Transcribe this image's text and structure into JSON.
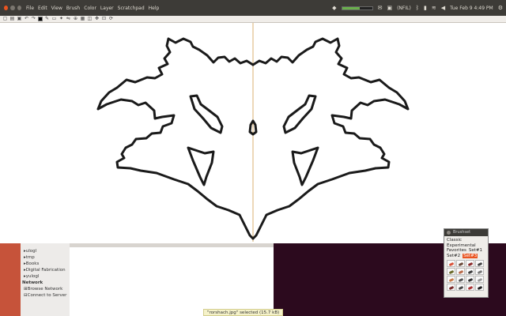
{
  "menubar": {
    "items": [
      "File",
      "Edit",
      "View",
      "Brush",
      "Color",
      "Layer",
      "Scratchpad",
      "Help"
    ]
  },
  "tray": {
    "keyboard": "(NFIL)",
    "battery_level": 0.6,
    "clock": "Tue Feb 9 4:49 PM"
  },
  "toolbar": {
    "icons": [
      "new-icon",
      "open-icon",
      "save-icon",
      "undo-icon",
      "redo-icon",
      "color-swatch",
      "brush-icon",
      "eraser-icon",
      "pick-icon",
      "mirror-icon",
      "zoom-icon",
      "grid-icon",
      "layer-icon",
      "move-icon",
      "fit-icon",
      "rotate-icon"
    ],
    "colors": {
      "swatch": "#000000"
    }
  },
  "sidebar": {
    "items": [
      {
        "label": "ulogl",
        "icon": "folder-icon"
      },
      {
        "label": "tmp",
        "icon": "folder-icon"
      },
      {
        "label": "Books",
        "icon": "folder-icon"
      },
      {
        "label": "Digital Fabrication",
        "icon": "folder-icon"
      },
      {
        "label": "yulogl",
        "icon": "folder-icon"
      }
    ],
    "network_heading": "Network",
    "network_items": [
      {
        "label": "Browse Network",
        "icon": "network-icon"
      },
      {
        "label": "Connect to Server",
        "icon": "server-icon"
      }
    ]
  },
  "status": {
    "selection": "\"rorshach.jpg\" selected (15.7 kB)"
  },
  "brush_panel": {
    "title": "Brushset",
    "groups": [
      "Classic",
      "Experimental",
      "Favorites",
      "Set#1",
      "Set#2",
      "Set#3"
    ],
    "active_group": "Set#3",
    "swatch_colors": [
      "#d9533a",
      "#6b4a3a",
      "#8a2b2b",
      "#444444",
      "#6b6b2a",
      "#b86a4a",
      "#3c3c3c",
      "#777777",
      "#c97b4a",
      "#555555",
      "#333333",
      "#999999",
      "#7a2a2a",
      "#4a4a4a",
      "#aa3333",
      "#222222"
    ]
  }
}
